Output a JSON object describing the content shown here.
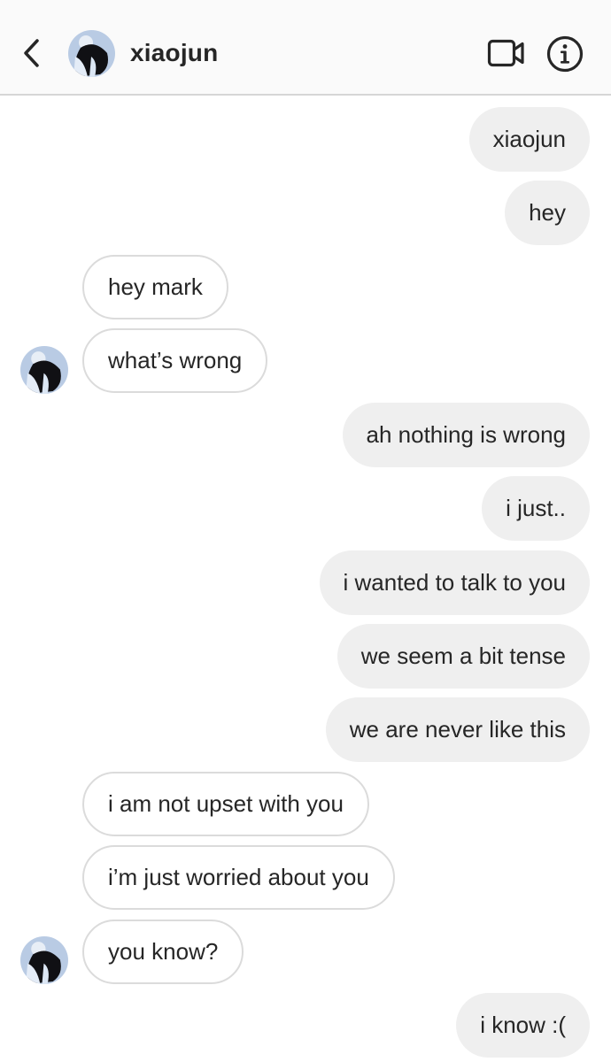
{
  "header": {
    "contact_name": "xiaojun",
    "icons": {
      "back": "chevron-left-icon",
      "video": "video-call-icon",
      "info": "info-icon"
    }
  },
  "colors": {
    "outgoing_bubble": "#efefef",
    "incoming_border": "#dbdbdb",
    "header_bg": "#fafafa",
    "text": "#262626"
  },
  "messages": [
    {
      "dir": "out",
      "text": "xiaojun"
    },
    {
      "dir": "out",
      "text": "hey"
    },
    {
      "dir": "in",
      "text": "hey mark"
    },
    {
      "dir": "in",
      "text": "what’s wrong",
      "avatar": true
    },
    {
      "dir": "out",
      "text": "ah nothing is wrong"
    },
    {
      "dir": "out",
      "text": "i just.."
    },
    {
      "dir": "out",
      "text": "i wanted to talk to you"
    },
    {
      "dir": "out",
      "text": "we seem a bit tense"
    },
    {
      "dir": "out",
      "text": "we are never like this"
    },
    {
      "dir": "in",
      "text": "i am not upset with you"
    },
    {
      "dir": "in",
      "text": "i’m just worried about you"
    },
    {
      "dir": "in",
      "text": "you know?",
      "avatar": true
    },
    {
      "dir": "out",
      "text": "i know :("
    }
  ]
}
